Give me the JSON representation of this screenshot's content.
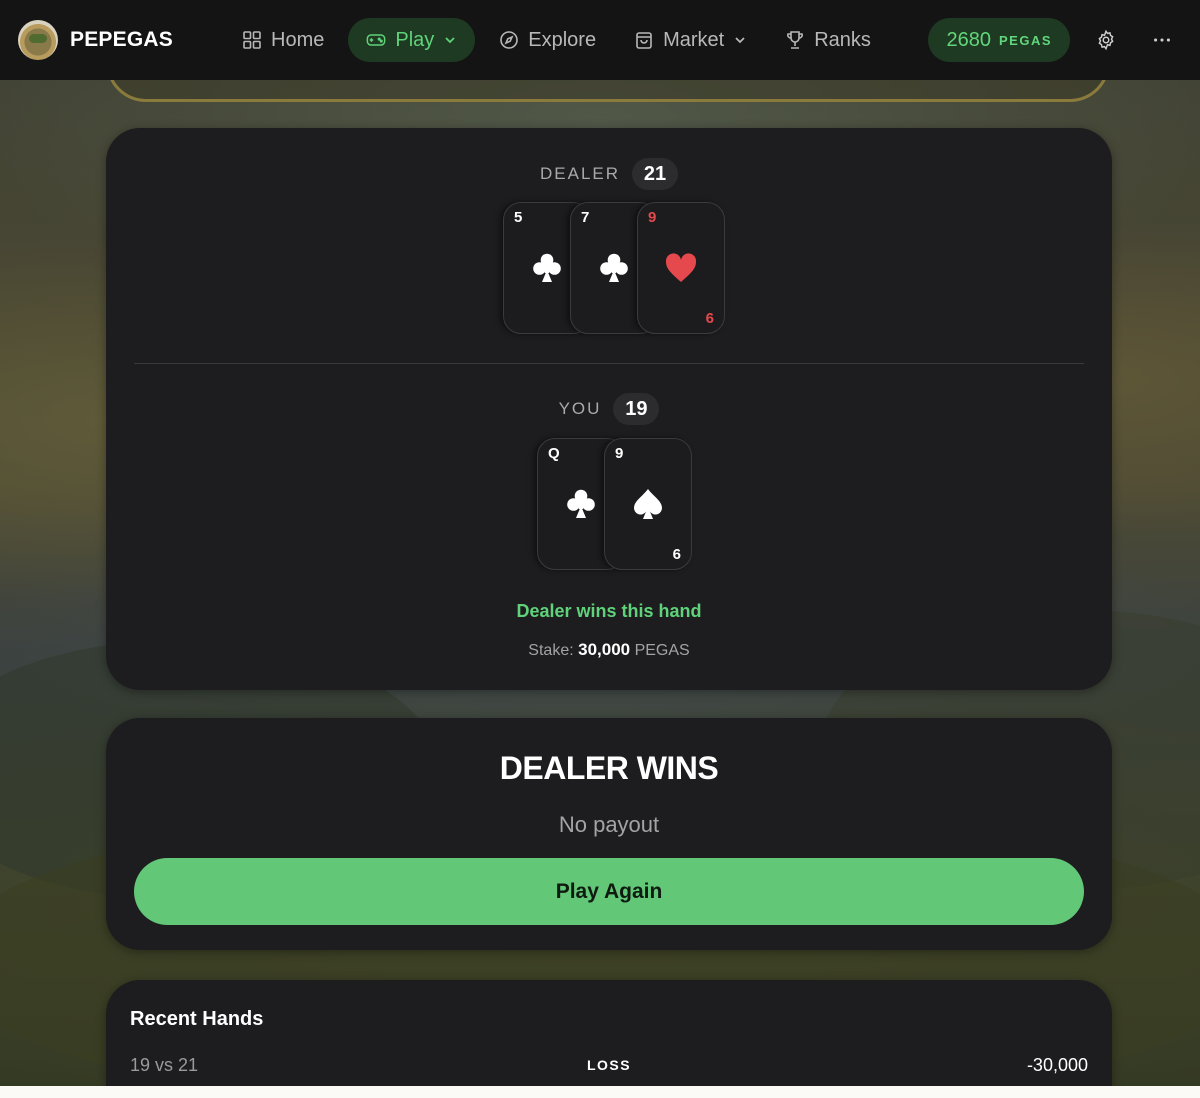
{
  "nav": {
    "brand": "PEPEGAS",
    "items": [
      {
        "label": "Home",
        "icon": "grid-icon"
      },
      {
        "label": "Play",
        "icon": "gamepad-icon"
      },
      {
        "label": "Explore",
        "icon": "compass-icon"
      },
      {
        "label": "Market",
        "icon": "shopping-bag-icon"
      },
      {
        "label": "Ranks",
        "icon": "trophy-icon"
      }
    ],
    "balance_amount": "2680",
    "balance_currency": "PEGAS"
  },
  "game": {
    "dealer": {
      "label": "DEALER",
      "score": "21",
      "cards": [
        {
          "rank": "5",
          "suit": "clubs",
          "bottom": ""
        },
        {
          "rank": "7",
          "suit": "clubs",
          "bottom": ""
        },
        {
          "rank": "9",
          "suit": "hearts",
          "bottom": "6"
        }
      ]
    },
    "player": {
      "label": "YOU",
      "score": "19",
      "cards": [
        {
          "rank": "Q",
          "suit": "clubs",
          "bottom": ""
        },
        {
          "rank": "9",
          "suit": "spades",
          "bottom": "6"
        }
      ]
    },
    "outcome": "Dealer wins this hand",
    "stake_label": "Stake:",
    "stake_amount": "30,000",
    "stake_currency": "PEGAS"
  },
  "result": {
    "title": "DEALER WINS",
    "subtitle": "No payout",
    "button_label": "Play Again"
  },
  "history": {
    "title": "Recent Hands",
    "rows": [
      {
        "hand": "19 vs 21",
        "result": "LOSS",
        "amount": "-30,000"
      }
    ]
  },
  "colors": {
    "accent_green": "#62c878",
    "accent_green_text": "#5fd27a",
    "card_bg": "#1d1d1f",
    "heart_red": "#e5484d"
  }
}
